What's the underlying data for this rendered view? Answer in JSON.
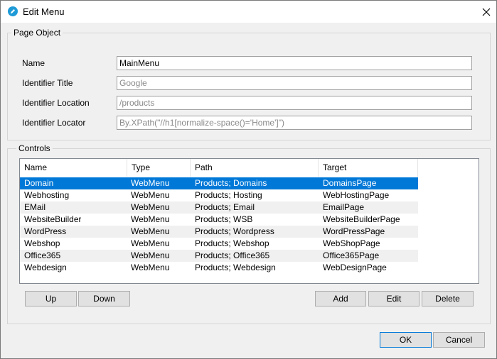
{
  "window": {
    "title": "Edit Menu"
  },
  "page_object": {
    "legend": "Page Object",
    "fields": [
      {
        "label": "Name",
        "value": "MainMenu",
        "placeholder": ""
      },
      {
        "label": "Identifier Title",
        "value": "",
        "placeholder": "Google"
      },
      {
        "label": "Identifier Location",
        "value": "",
        "placeholder": "/products"
      },
      {
        "label": "Identifier Locator",
        "value": "",
        "placeholder": "By.XPath(\"//h1[normalize-space()='Home']\")"
      }
    ]
  },
  "controls": {
    "legend": "Controls",
    "columns": [
      "Name",
      "Type",
      "Path",
      "Target"
    ],
    "rows": [
      {
        "name": "Domain",
        "type": "WebMenu",
        "path": "Products; Domains",
        "target": "DomainsPage",
        "selected": true
      },
      {
        "name": "Webhosting",
        "type": "WebMenu",
        "path": "Products; Hosting",
        "target": "WebHostingPage"
      },
      {
        "name": "EMail",
        "type": "WebMenu",
        "path": "Products; Email",
        "target": "EmailPage"
      },
      {
        "name": "WebsiteBuilder",
        "type": "WebMenu",
        "path": "Products; WSB",
        "target": "WebsiteBuilderPage"
      },
      {
        "name": "WordPress",
        "type": "WebMenu",
        "path": "Products; Wordpress",
        "target": "WordPressPage"
      },
      {
        "name": "Webshop",
        "type": "WebMenu",
        "path": "Products; Webshop",
        "target": "WebShopPage"
      },
      {
        "name": "Office365",
        "type": "WebMenu",
        "path": "Products; Office365",
        "target": "Office365Page"
      },
      {
        "name": "Webdesign",
        "type": "WebMenu",
        "path": "Products; Webdesign",
        "target": "WebDesignPage"
      }
    ],
    "buttons": {
      "up": "Up",
      "down": "Down",
      "add": "Add",
      "edit": "Edit",
      "delete": "Delete"
    }
  },
  "footer": {
    "ok": "OK",
    "cancel": "Cancel"
  },
  "colors": {
    "selection": "#0078d7",
    "accent_icon": "#1e9bd7",
    "window_bg": "#f0f0f0"
  },
  "icons": {
    "app": "pencil-circle-icon",
    "close": "close-icon"
  }
}
